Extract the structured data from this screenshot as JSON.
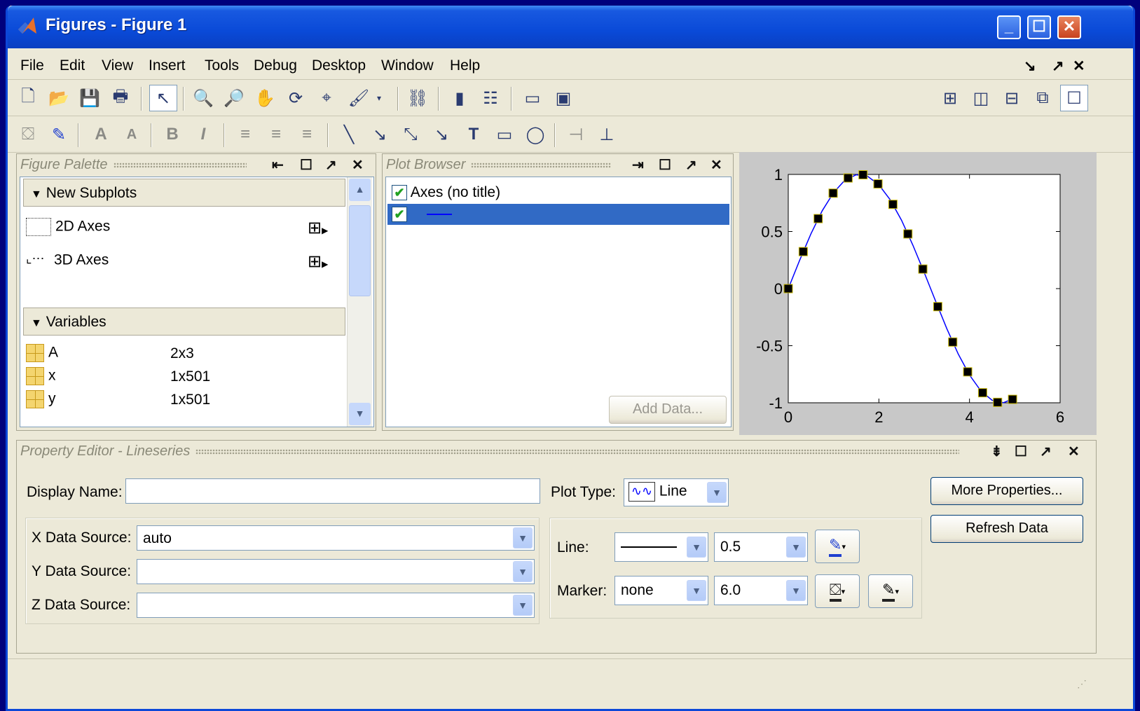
{
  "window": {
    "title": "Figures - Figure 1"
  },
  "menu": [
    "File",
    "Edit",
    "View",
    "Insert",
    "Tools",
    "Debug",
    "Desktop",
    "Window",
    "Help"
  ],
  "palette": {
    "header": "Figure Palette",
    "new_subplots": "New Subplots",
    "axes2d": "2D Axes",
    "axes3d": "3D Axes",
    "variables_header": "Variables",
    "variables": [
      {
        "name": "A",
        "size": "2x3"
      },
      {
        "name": "x",
        "size": "1x501"
      },
      {
        "name": "y",
        "size": "1x501"
      }
    ]
  },
  "browser": {
    "header": "Plot Browser",
    "axes_item": "Axes (no title)",
    "add_data": "Add Data..."
  },
  "editor": {
    "header": "Property Editor - Lineseries",
    "display_name_label": "Display Name:",
    "display_name_value": "",
    "x_source_label": "X Data Source:",
    "x_source_value": "auto",
    "y_source_label": "Y Data Source:",
    "y_source_value": "",
    "z_source_label": "Z Data Source:",
    "z_source_value": "",
    "plot_type_label": "Plot Type:",
    "plot_type_value": "Line",
    "line_label": "Line:",
    "line_width": "0.5",
    "marker_label": "Marker:",
    "marker_value": "none",
    "marker_size": "6.0",
    "more_properties": "More Properties...",
    "refresh_data": "Refresh Data"
  },
  "colors": {
    "line": "#0000ff",
    "marker": "#000000",
    "selection": "#316ac5"
  },
  "chart_data": {
    "type": "line",
    "series": [
      {
        "style": "curve",
        "x": [
          0,
          0.25,
          0.5,
          0.75,
          1,
          1.25,
          1.5,
          1.75,
          2,
          2.25,
          2.5,
          2.75,
          3,
          3.25,
          3.5,
          3.75,
          4,
          4.25,
          4.5,
          4.75,
          5
        ],
        "y": [
          0,
          0.247,
          0.479,
          0.682,
          0.841,
          0.949,
          0.997,
          0.984,
          0.909,
          0.778,
          0.598,
          0.381,
          0.141,
          -0.108,
          -0.351,
          -0.572,
          -0.757,
          -0.895,
          -0.978,
          -0.999,
          -0.959
        ]
      },
      {
        "style": "markers",
        "x": [
          0,
          0.33,
          0.66,
          0.99,
          1.32,
          1.65,
          1.98,
          2.31,
          2.64,
          2.97,
          3.3,
          3.63,
          3.96,
          4.29,
          4.62,
          4.95
        ],
        "y": [
          0,
          0.324,
          0.613,
          0.836,
          0.969,
          0.997,
          0.917,
          0.738,
          0.479,
          0.171,
          -0.158,
          -0.468,
          -0.729,
          -0.912,
          -0.996,
          -0.97
        ]
      }
    ],
    "xlim": [
      0,
      6
    ],
    "ylim": [
      -1,
      1
    ],
    "xticks": [
      "0",
      "2",
      "4",
      "6"
    ],
    "yticks": [
      "1",
      "0.5",
      "0",
      "-0.5",
      "-1"
    ]
  }
}
